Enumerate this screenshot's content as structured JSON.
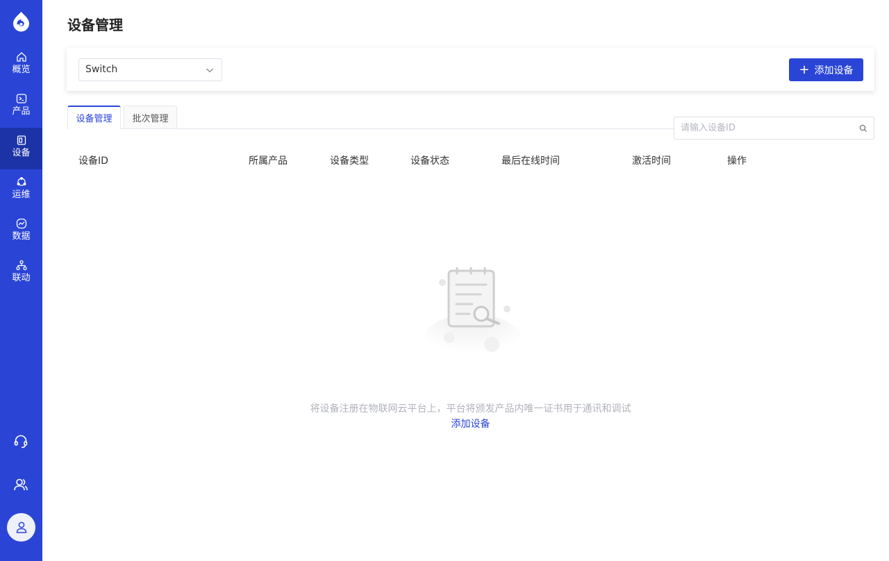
{
  "colors": {
    "primary": "#2a45d6",
    "sidebar_active": "#1c33a8"
  },
  "sidebar": {
    "items": [
      {
        "label": "概览",
        "icon": "home-icon"
      },
      {
        "label": "产品",
        "icon": "terminal-icon"
      },
      {
        "label": "设备",
        "icon": "device-icon",
        "active": true
      },
      {
        "label": "运维",
        "icon": "ops-icon"
      },
      {
        "label": "数据",
        "icon": "chart-icon"
      },
      {
        "label": "联动",
        "icon": "linkage-icon"
      }
    ],
    "bottom": [
      "headset-icon",
      "users-icon",
      "user-avatar-icon"
    ]
  },
  "page": {
    "title": "设备管理"
  },
  "filter": {
    "product_value": "Switch",
    "add_button_label": "添加设备"
  },
  "tabs": [
    {
      "label": "设备管理",
      "active": true
    },
    {
      "label": "批次管理"
    }
  ],
  "search": {
    "placeholder": "请输入设备ID"
  },
  "table": {
    "columns": [
      "设备ID",
      "所属产品",
      "设备类型",
      "设备状态",
      "最后在线时间",
      "激活时间",
      "操作"
    ]
  },
  "empty": {
    "message": "将设备注册在物联网云平台上，平台将颁发产品内唯一证书用于通讯和调试",
    "link": "添加设备"
  }
}
